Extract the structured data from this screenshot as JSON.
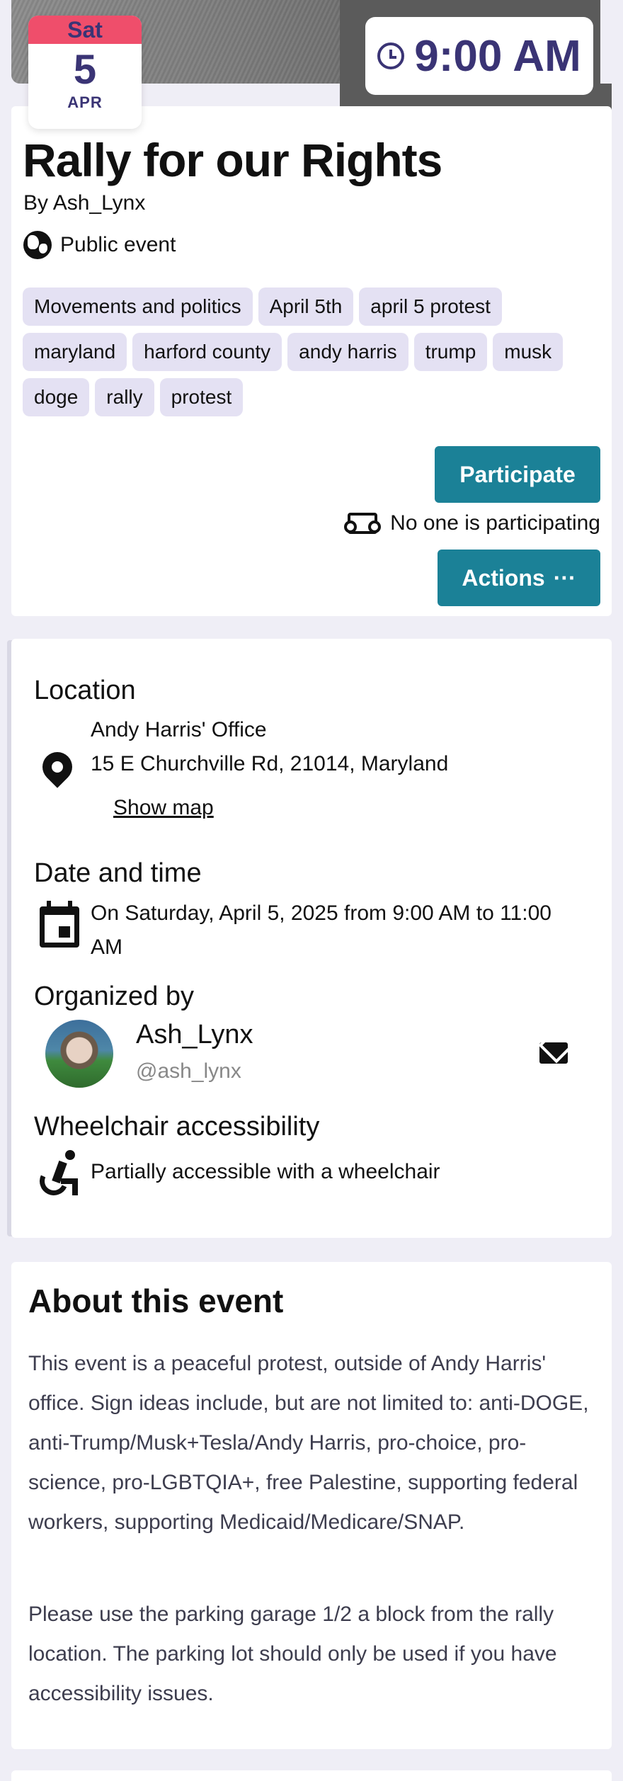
{
  "date_badge": {
    "day_of_week": "Sat",
    "day": "5",
    "month": "APR"
  },
  "time_badge": {
    "time": "9:00 AM",
    "icon": "clock-icon"
  },
  "event": {
    "title": "Rally for our Rights",
    "byline": "By Ash_Lynx",
    "visibility": "Public event",
    "tags": [
      "Movements and politics",
      "April 5th",
      "april 5 protest",
      "maryland",
      "harford county",
      "andy harris",
      "trump",
      "musk",
      "doge",
      "rally",
      "protest"
    ],
    "participate_label": "Participate",
    "participants_text": "No one is participating",
    "actions_label": "Actions",
    "actions_more": "···"
  },
  "details": {
    "location_heading": "Location",
    "location_name": "Andy Harris' Office",
    "location_address": "15 E Churchville Rd, 21014, Maryland",
    "show_map_label": "Show map",
    "datetime_heading": "Date and time",
    "datetime_text": "On Saturday, April 5, 2025 from 9:00 AM to 11:00 AM",
    "organizer_heading": "Organized by",
    "organizer_name": "Ash_Lynx",
    "organizer_handle": "@ash_lynx",
    "accessibility_heading": "Wheelchair accessibility",
    "accessibility_text": "Partially accessible with a wheelchair"
  },
  "about": {
    "heading": "About this event",
    "paragraph1": "This event is a peaceful protest, outside of Andy Harris' office. Sign ideas include, but are not limited to: anti-DOGE, anti-Trump/Musk+Tesla/Andy Harris, pro-choice, pro-science, pro-LGBTQIA+, free Palestine, supporting federal workers, supporting Medicaid/Medicare/SNAP.",
    "paragraph2": "Please use the parking garage 1/2 a block from the rally location. The parking lot should only be used if you have accessibility issues."
  },
  "colors": {
    "accent": "#1b8197",
    "brand": "#3a3475",
    "date_header": "#ef4e6b",
    "tag_bg": "#e4e1f3",
    "page_bg": "#efeef6"
  }
}
